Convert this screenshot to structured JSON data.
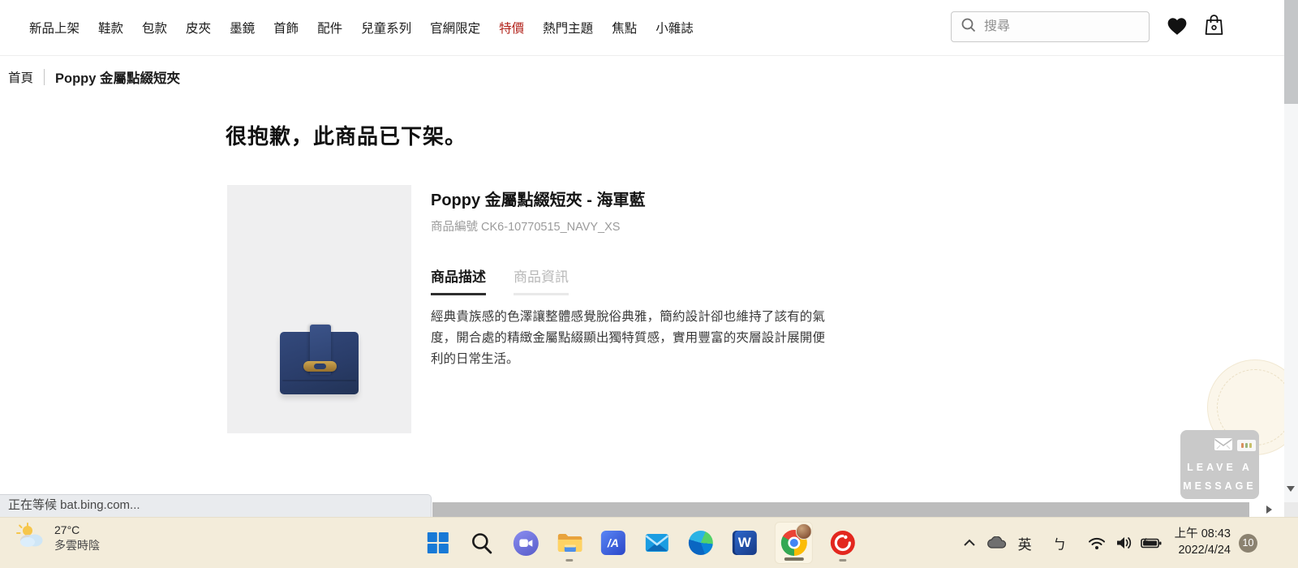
{
  "nav": {
    "items": [
      {
        "label": "新品上架",
        "hot": false
      },
      {
        "label": "鞋款",
        "hot": false
      },
      {
        "label": "包款",
        "hot": false
      },
      {
        "label": "皮夾",
        "hot": false
      },
      {
        "label": "墨鏡",
        "hot": false
      },
      {
        "label": "首飾",
        "hot": false
      },
      {
        "label": "配件",
        "hot": false
      },
      {
        "label": "兒童系列",
        "hot": false
      },
      {
        "label": "官網限定",
        "hot": false
      },
      {
        "label": "特價",
        "hot": true
      },
      {
        "label": "熱門主題",
        "hot": false
      },
      {
        "label": "焦點",
        "hot": false
      },
      {
        "label": "小雜誌",
        "hot": false
      }
    ]
  },
  "search": {
    "placeholder": "搜尋"
  },
  "header_icons": [
    "search-icon",
    "heart-icon",
    "shopping-bag-icon"
  ],
  "breadcrumb": {
    "home": "首頁",
    "current": "Poppy 金屬點綴短夾"
  },
  "main": {
    "heading": "很抱歉，此商品已下架。",
    "product": {
      "title": "Poppy 金屬點綴短夾 - 海軍藍",
      "sku": "商品編號 CK6-10770515_NAVY_XS",
      "tabs": [
        {
          "label": "商品描述",
          "active": true
        },
        {
          "label": "商品資訊",
          "active": false
        }
      ],
      "description": "經典貴族感的色澤讓整體感覺脫俗典雅，簡約設計卻也維持了該有的氣度，開合處的精緻金屬點綴顯出獨特質感，實用豐富的夾層設計展開便利的日常生活。"
    }
  },
  "chat_widget": {
    "line1": "LEAVE A",
    "line2": "MESSAGE",
    "icon": "envelope-icon"
  },
  "status_bar": {
    "text": "正在等候 bat.bing.com..."
  },
  "taskbar": {
    "weather": {
      "temp": "27°C",
      "condition": "多雲時陰"
    },
    "apps": [
      "windows-start",
      "search",
      "teams-chat",
      "file-explorer",
      "blue-a-app",
      "mail",
      "edge",
      "word",
      "chrome",
      "trend-micro"
    ],
    "tray": {
      "icons": [
        "chevron-up-icon",
        "onedrive-cloud-icon",
        "wifi-icon",
        "volume-icon",
        "battery-charging-icon"
      ],
      "language": "英",
      "ime": "ㄅ",
      "time": "上午 08:43",
      "date": "2022/4/24",
      "badge_count": "10"
    }
  },
  "colors": {
    "accent_red": "#b3261e",
    "taskbar_bg": "#f3ecda",
    "wallet_navy": "#2c3f6c",
    "wallet_gold": "#b98f3e",
    "tab_underline": "#2e2e2e",
    "widget_gray": "#c9c9c9"
  }
}
